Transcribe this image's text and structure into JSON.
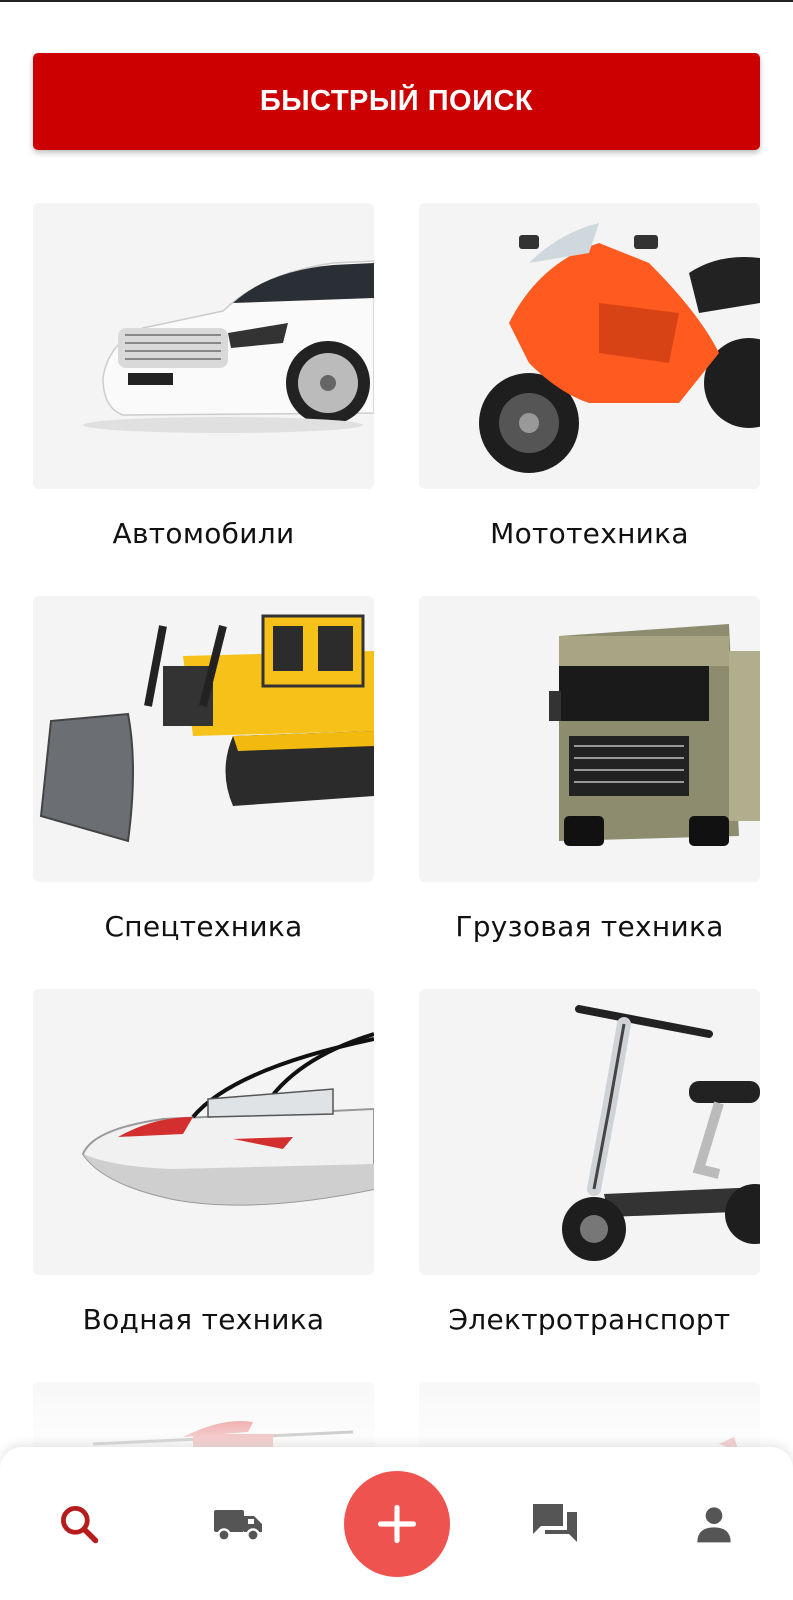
{
  "quick_search": {
    "label": "БЫСТРЫЙ ПОИСК"
  },
  "categories": [
    {
      "label": "Автомобили",
      "icon": "car-image"
    },
    {
      "label": "Мототехника",
      "icon": "motorcycle-image"
    },
    {
      "label": "Спецтехника",
      "icon": "bulldozer-image"
    },
    {
      "label": "Грузовая техника",
      "icon": "truck-image"
    },
    {
      "label": "Водная техника",
      "icon": "boat-image"
    },
    {
      "label": "Электротранспорт",
      "icon": "electric-scooter-image"
    }
  ],
  "bottom_nav": {
    "items": [
      {
        "icon": "search-icon",
        "active": true
      },
      {
        "icon": "truck-icon",
        "active": false
      },
      {
        "icon": "add-icon",
        "active": false
      },
      {
        "icon": "chat-icon",
        "active": false
      },
      {
        "icon": "profile-icon",
        "active": false
      }
    ]
  },
  "colors": {
    "accent": "#cc0000",
    "fab": "#ef5350",
    "active_icon": "#b71c1c",
    "inactive_icon": "#555555",
    "card_bg": "#f4f4f4"
  }
}
